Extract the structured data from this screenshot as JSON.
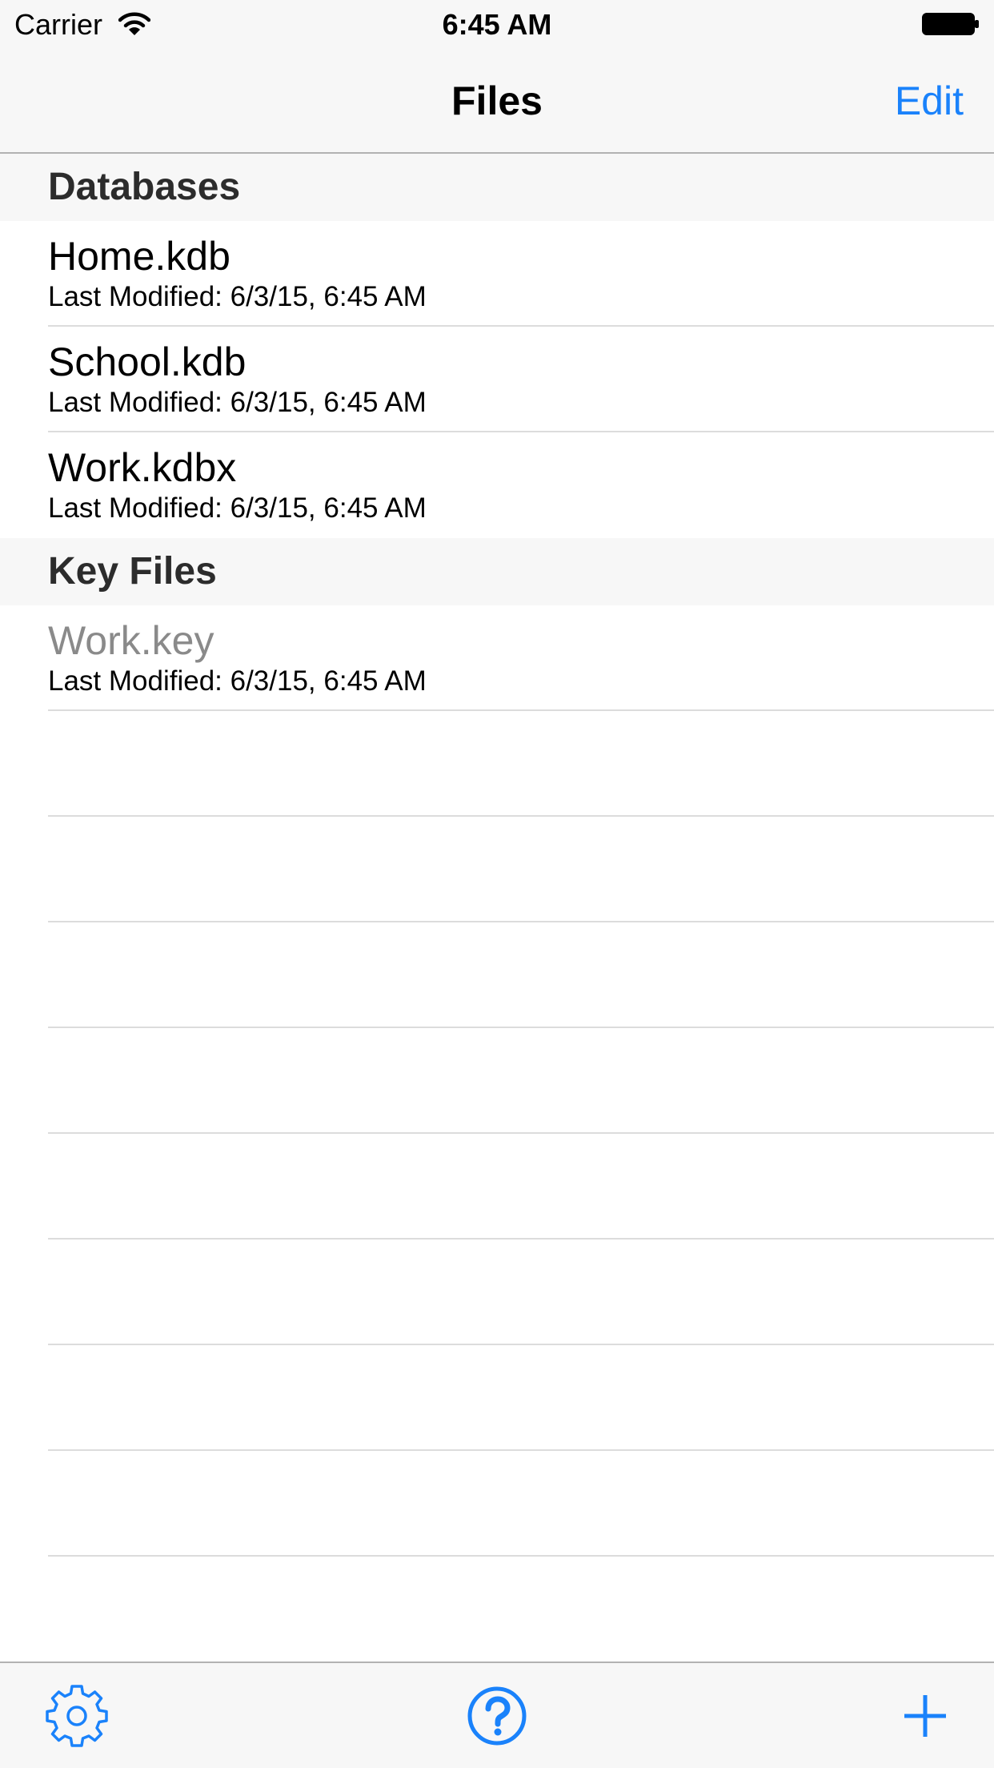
{
  "status_bar": {
    "carrier": "Carrier",
    "time": "6:45 AM"
  },
  "nav": {
    "title": "Files",
    "edit_label": "Edit"
  },
  "sections": [
    {
      "title": "Databases",
      "items": [
        {
          "name": "Home.kdb",
          "modified": "Last Modified: 6/3/15, 6:45 AM"
        },
        {
          "name": "School.kdb",
          "modified": "Last Modified: 6/3/15, 6:45 AM"
        },
        {
          "name": "Work.kdbx",
          "modified": "Last Modified: 6/3/15, 6:45 AM"
        }
      ]
    },
    {
      "title": "Key Files",
      "items": [
        {
          "name": "Work.key",
          "modified": "Last Modified: 6/3/15, 6:45 AM"
        }
      ]
    }
  ],
  "toolbar": {
    "left_icon": "gear-icon",
    "center_icon": "help-icon",
    "right_icon": "plus-icon"
  },
  "colors": {
    "accent": "#1a82fb",
    "bar_bg": "#f7f7f7",
    "dimmed_text": "#8a8a8a"
  }
}
